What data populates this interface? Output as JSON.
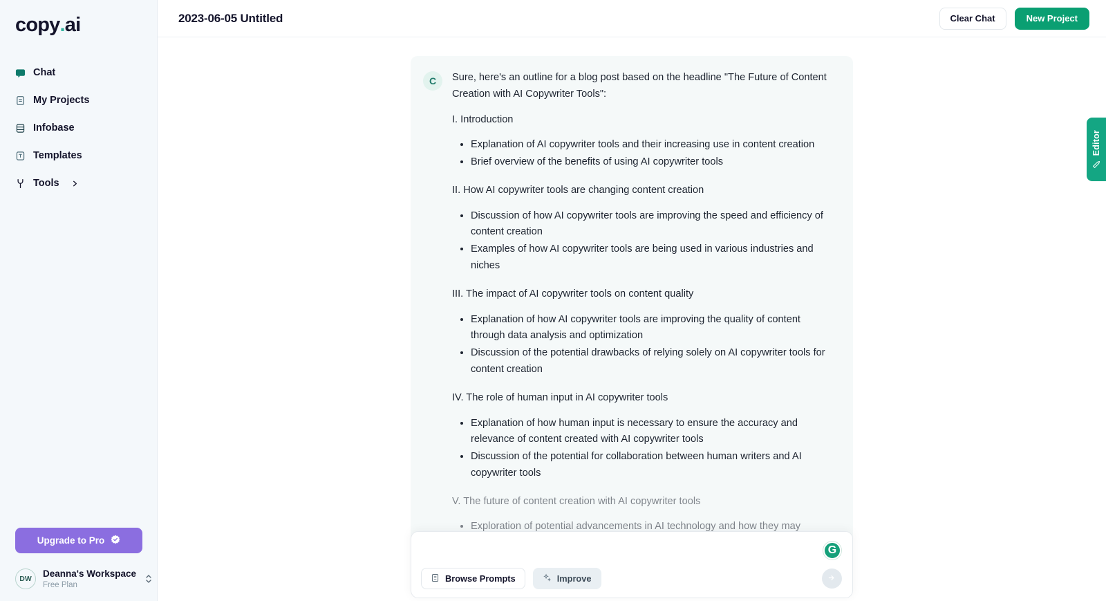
{
  "sidebar": {
    "logo": {
      "text": "copy",
      "dot": ".",
      "suffix": "ai"
    },
    "items": [
      {
        "label": "Chat",
        "icon": "chat-icon",
        "active": true
      },
      {
        "label": "My Projects",
        "icon": "document-icon",
        "active": false
      },
      {
        "label": "Infobase",
        "icon": "database-icon",
        "active": false
      },
      {
        "label": "Templates",
        "icon": "template-icon",
        "active": false
      },
      {
        "label": "Tools",
        "icon": "wrench-icon",
        "active": false,
        "chevron": "chevron-right-icon"
      }
    ],
    "upgrade": {
      "label": "Upgrade to Pro",
      "icon": "verified-badge-icon",
      "color": "#8b6ee0"
    },
    "workspace": {
      "initials": "DW",
      "name": "Deanna's Workspace",
      "plan": "Free Plan"
    }
  },
  "topbar": {
    "title": "2023-06-05 Untitled",
    "clear_chat_label": "Clear Chat",
    "new_project_label": "New Project",
    "primary_color": "#0a9f72"
  },
  "editor_tab": {
    "label": "Editor",
    "icon": "pencil-icon",
    "color": "#14a683"
  },
  "chat": {
    "message": {
      "avatar_initial": "C",
      "intro": "Sure, here's an outline for a blog post based on the headline \"The Future of Content Creation with AI Copywriter Tools\":",
      "sections": [
        {
          "heading": "I. Introduction",
          "bullets": [
            "Explanation of AI copywriter tools and their increasing use in content creation",
            "Brief overview of the benefits of using AI copywriter tools"
          ],
          "faded": false
        },
        {
          "heading": "II. How AI copywriter tools are changing content creation",
          "bullets": [
            "Discussion of how AI copywriter tools are improving the speed and efficiency of content creation",
            "Examples of how AI copywriter tools are being used in various industries and niches"
          ],
          "faded": false
        },
        {
          "heading": "III. The impact of AI copywriter tools on content quality",
          "bullets": [
            "Explanation of how AI copywriter tools are improving the quality of content through data analysis and optimization",
            "Discussion of the potential drawbacks of relying solely on AI copywriter tools for content creation"
          ],
          "faded": false
        },
        {
          "heading": "IV. The role of human input in AI copywriter tools",
          "bullets": [
            "Explanation of how human input is necessary to ensure the accuracy and relevance of content created with AI copywriter tools",
            "Discussion of the potential for collaboration between human writers and AI copywriter tools"
          ],
          "faded": false
        },
        {
          "heading": "V. The future of content creation with AI copywriter tools",
          "bullets": [
            "Exploration of potential advancements in AI technology and how they may"
          ],
          "faded": true
        }
      ]
    }
  },
  "composer": {
    "value": "",
    "placeholder": "",
    "browse_prompts_label": "Browse Prompts",
    "improve_label": "Improve",
    "grammarly_label": "G",
    "send_icon": "send-icon"
  }
}
